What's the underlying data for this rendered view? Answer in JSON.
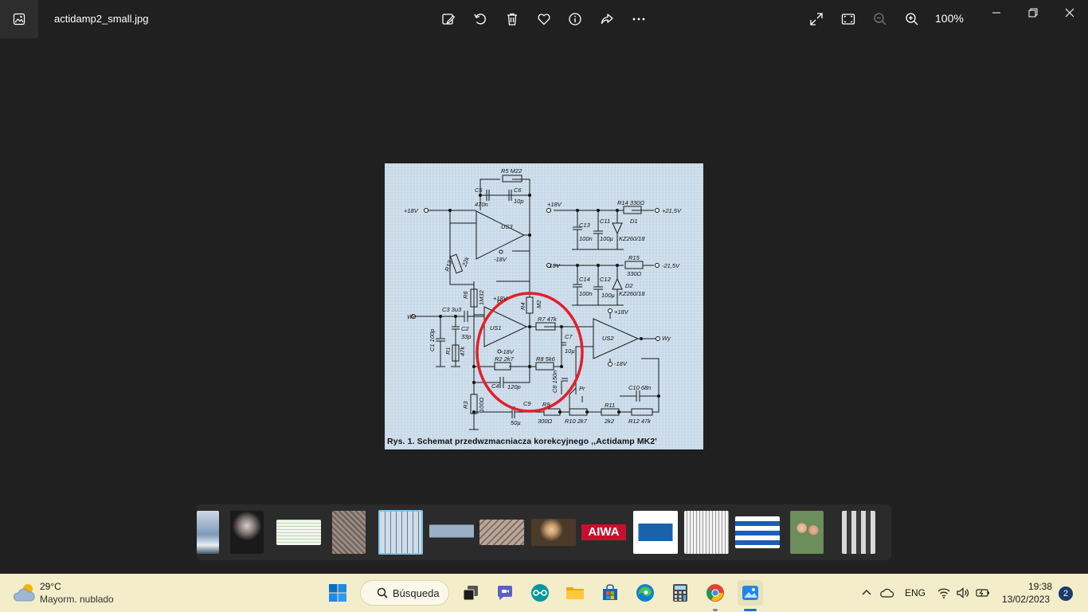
{
  "titlebar": {
    "file_name": "actidamp2_small.jpg",
    "zoom_level": "100%",
    "icons": [
      "edit-image-icon",
      "rotate-icon",
      "delete-icon",
      "favorite-icon",
      "info-icon",
      "share-icon",
      "more-icon",
      "fullscreen-icon",
      "fit-window-icon",
      "zoom-out-icon",
      "zoom-in-icon"
    ]
  },
  "schematic": {
    "caption": "Rys. 1. Schemat przedwzmacniacza korekcyjnego ,,Actidamp MK2'",
    "labels": {
      "r5": "R5 M22",
      "c5": "C5",
      "c5v": "470n",
      "c6": "C6",
      "c6v": "10p",
      "p18": "+18V",
      "us3": "US3",
      "m18a": "-18V",
      "r13": "R13",
      "r13v": "22k",
      "r6": "R6",
      "r6v": "1M32",
      "r4": "R4",
      "r4v": "M2",
      "we": "We",
      "c3": "C3 3u3",
      "c2": "C2",
      "c2v": "33p",
      "c1": "C1 100p",
      "r1": "R1",
      "r1v": "47k",
      "us1": "US1",
      "p18b": "+18V",
      "m18b": "-18V",
      "r7": "R7 47k",
      "r8": "R8 5k6",
      "c7": "C7",
      "c7v": "10µ",
      "c8": "C8 150n",
      "r2": "R2 2k7",
      "c4": "C4",
      "c4v": "120p",
      "r3": "R3",
      "r3v": "100Ω",
      "c9": "C9",
      "c9v": "50µ",
      "r9": "R9",
      "r9v": "300Ω",
      "pr": "Pr",
      "r10": "R10 2k7",
      "r11": "R11",
      "r11v": "2k2",
      "r12": "R12 47k",
      "c10": "C10 68n",
      "us2": "US2",
      "p18c": "+18V",
      "m18c": "-18V",
      "wy": "Wy",
      "p18d": "+18V",
      "r14": "R14 330Ω",
      "p215": "+21,5V",
      "c13": "C13",
      "c13v": "100n",
      "c11": "C11",
      "c11v": "100µ",
      "d1": "D1",
      "d1v": "KZ260/18",
      "m18d": "-18V",
      "r15": "R15",
      "r15v": "330Ω",
      "m215": "-21,5V",
      "c14": "C14",
      "c14v": "100n",
      "c12": "C12",
      "c12v": "100µ",
      "d2": "D2",
      "d2v": "KZ260/18"
    }
  },
  "filmstrip": {
    "thumbnails": [
      {
        "name": "thumb-snow-landscape",
        "color": "#8aa6c4"
      },
      {
        "name": "thumb-dark-lamp",
        "color": "#1a1a1a"
      },
      {
        "name": "thumb-table-document",
        "color": "#e6e6e6"
      },
      {
        "name": "thumb-circuit-board",
        "color": "#8c7f77"
      },
      {
        "name": "thumb-schematic",
        "color": "#cfdde9",
        "selected": true
      },
      {
        "name": "thumb-screenshot",
        "color": "#3a3a3a"
      },
      {
        "name": "thumb-pcb-photo",
        "color": "#a89488"
      },
      {
        "name": "thumb-person-photo",
        "color": "#6e5a43"
      },
      {
        "name": "thumb-aiwa-logo",
        "color": "#c8102e",
        "text": "AIWA"
      },
      {
        "name": "thumb-arduino-nano",
        "color": "#ffffff"
      },
      {
        "name": "thumb-breadboard",
        "color": "#f2f2f2"
      },
      {
        "name": "thumb-uruguay-flag",
        "color": "#ffffff"
      },
      {
        "name": "thumb-couple-photo",
        "color": "#7a9b6a"
      },
      {
        "name": "thumb-group-photo",
        "color": "#555555"
      }
    ]
  },
  "taskbar": {
    "weather_temp": "29°C",
    "weather_desc": "Mayorm. nublado",
    "search_label": "Búsqueda",
    "language": "ENG",
    "time": "19:38",
    "date": "13/02/2023",
    "notification_count": "2",
    "colors": {
      "accent": "#0078d4",
      "bar": "#f3edc9"
    }
  }
}
